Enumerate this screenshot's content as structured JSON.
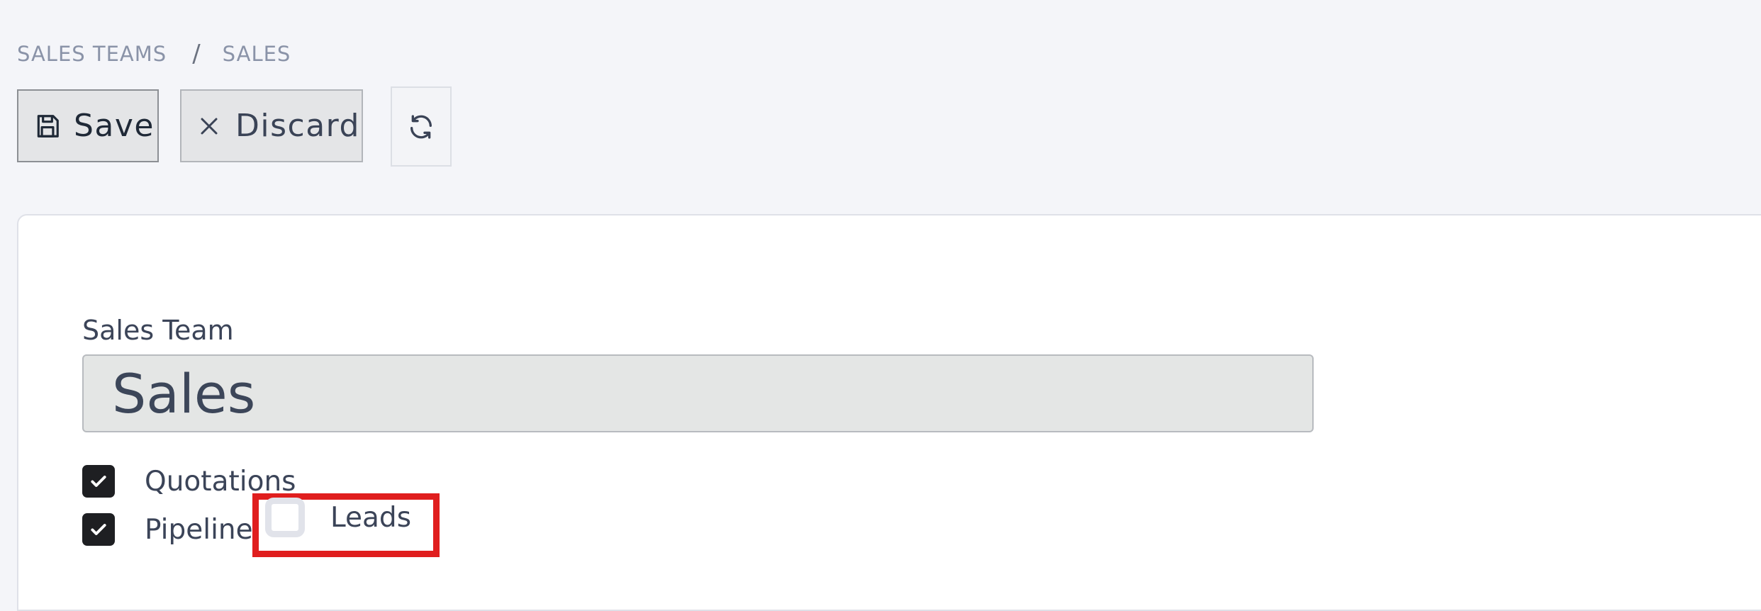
{
  "breadcrumb": {
    "parent": "SALES TEAMS",
    "separator": "/",
    "current": "SALES"
  },
  "toolbar": {
    "save_label": "Save",
    "discard_label": "Discard",
    "save_icon": "floppy-disk-icon",
    "discard_icon": "close-icon",
    "reload_icon": "refresh-icon"
  },
  "form": {
    "name_label": "Sales Team",
    "name_value": "Sales",
    "options": {
      "quotations": {
        "label": "Quotations",
        "checked": true
      },
      "pipeline": {
        "label": "Pipeline",
        "checked": true
      },
      "leads": {
        "label": "Leads",
        "checked": false
      }
    }
  },
  "colors": {
    "highlight": "#e01e1e",
    "checkbox_checked": "#1e1f22",
    "background": "#f4f5f9"
  }
}
